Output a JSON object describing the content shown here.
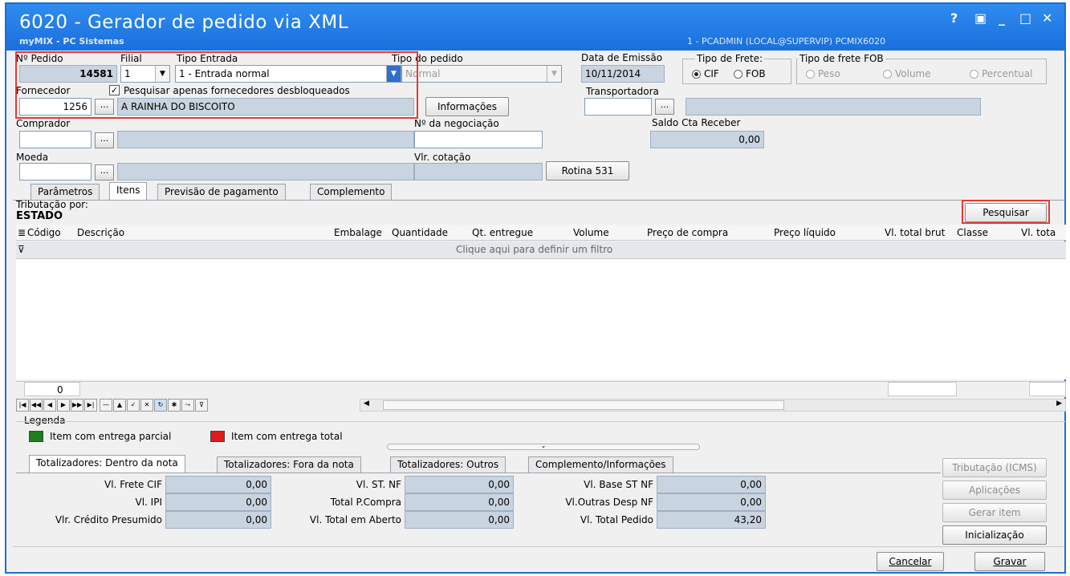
{
  "window": {
    "title": "6020 - Gerador de pedido via XML",
    "subtitle": "myMIX - PC Sistemas",
    "userinfo": "1 - PCADMIN (LOCAL@SUPERVIP)  PCMIX6020",
    "controls": {
      "help": "?",
      "restore": "▣",
      "minimize": "_",
      "maximize": "□",
      "close": "✕"
    }
  },
  "header": {
    "pedido_label": "Nº Pedido",
    "pedido_value": "14581",
    "filial_label": "Filial",
    "filial_value": "1",
    "tipo_entrada_label": "Tipo Entrada",
    "tipo_entrada_value": "1 - Entrada normal",
    "tipo_pedido_label": "Tipo do pedido",
    "tipo_pedido_value": "Normal",
    "data_emissao_label": "Data de Emissão",
    "data_emissao_value": "10/11/2014",
    "tipo_frete_label": "Tipo de Frete:",
    "frete_cif": "CIF",
    "frete_fob": "FOB",
    "tipo_frete_fob_label": "Tipo de frete FOB",
    "fob_peso": "Peso",
    "fob_volume": "Volume",
    "fob_percentual": "Percentual",
    "fornecedor_label": "Fornecedor",
    "fornecedor_code": "1256",
    "fornecedor_name": "A RAINHA DO BISCOITO",
    "pesquisar_desbloq_label": "Pesquisar apenas fornecedores desbloqueados",
    "informacoes_button": "Informações",
    "transportadora_label": "Transportadora",
    "comprador_label": "Comprador",
    "negociacao_label": "Nº da negociação",
    "saldo_label": "Saldo Cta Receber",
    "saldo_value": "0,00",
    "moeda_label": "Moeda",
    "cotacao_label": "Vlr. cotação",
    "rotina_button": "Rotina 531",
    "dots": "..."
  },
  "tabs": [
    "Parâmetros",
    "Itens",
    "Previsão de pagamento",
    "Complemento"
  ],
  "items": {
    "tributacao_label": "Tributação por:",
    "tributacao_value": "ESTADO",
    "pesquisar_button": "Pesquisar",
    "columns": [
      "Código",
      "Descrição",
      "Embalage",
      "Quantidade",
      "Qt. entregue",
      "Volume",
      "Preço de compra",
      "Preço líquido",
      "Vl. total brut",
      "Classe",
      "Vl. tota"
    ],
    "filter_hint": "Clique aqui para definir um filtro",
    "count": "0"
  },
  "legend": {
    "title": "Legenda",
    "parcial": "Item com entrega parcial",
    "total": "Item com entrega total",
    "parcial_color": "#1e7d1e",
    "total_color": "#e01b1b"
  },
  "totals_tabs": [
    "Totalizadores: Dentro da nota",
    "Totalizadores: Fora da nota",
    "Totalizadores: Outros",
    "Complemento/Informações"
  ],
  "totals": {
    "frete_cif_label": "Vl. Frete CIF",
    "frete_cif_value": "0,00",
    "ipi_label": "Vl. IPI",
    "ipi_value": "0,00",
    "credito_label": "Vlr. Crédito Presumido",
    "credito_value": "0,00",
    "st_nf_label": "Vl. ST. NF",
    "st_nf_value": "0,00",
    "total_compra_label": "Total P.Compra",
    "total_compra_value": "0,00",
    "total_aberto_label": "Vl. Total em Aberto",
    "total_aberto_value": "0,00",
    "base_st_label": "Vl. Base ST NF",
    "base_st_value": "0,00",
    "outras_desp_label": "Vl.Outras Desp NF",
    "outras_desp_value": "0,00",
    "total_pedido_label": "Vl. Total  Pedido",
    "total_pedido_value": "43,20"
  },
  "side_buttons": {
    "tributacao": "Tributação (ICMS)",
    "aplicacoes": "Aplicações",
    "gerar_item": "Gerar item",
    "inicializacao": "Inicialização"
  },
  "footer": {
    "cancelar": "Cancelar",
    "gravar": "Gravar"
  }
}
